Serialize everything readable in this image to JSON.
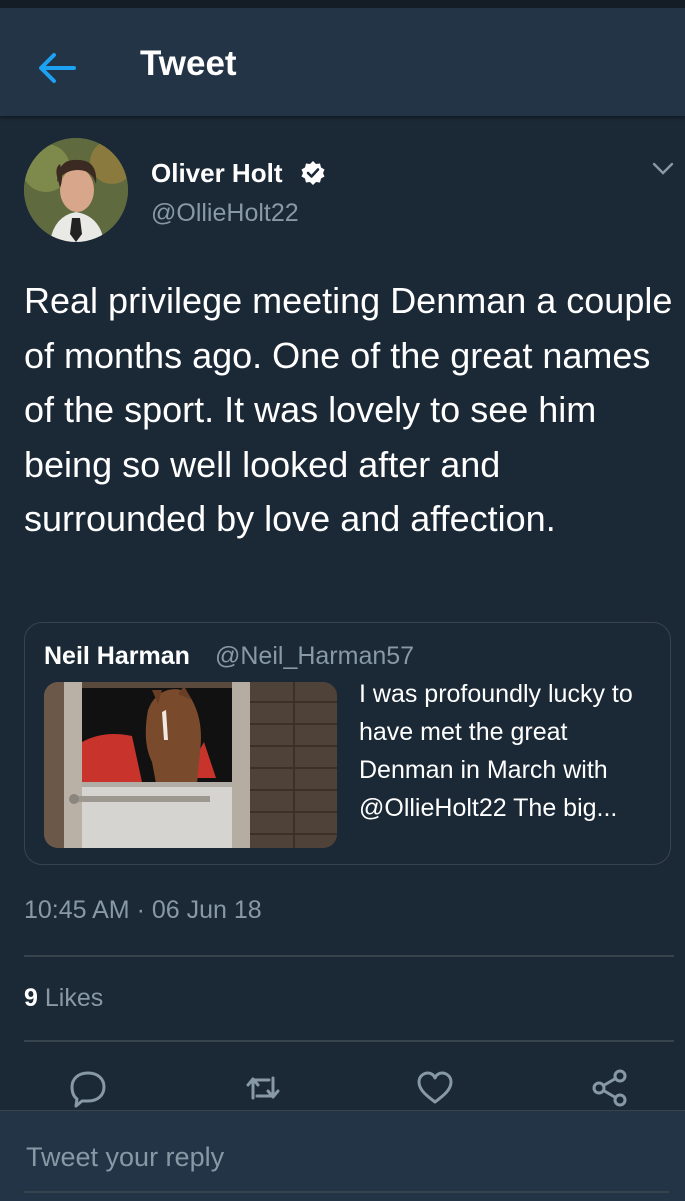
{
  "header": {
    "title": "Tweet",
    "back_icon": "arrow-left-icon"
  },
  "tweet": {
    "author_name": "Oliver Holt",
    "author_handle": "@OllieHolt22",
    "verified": true,
    "text": "Real privilege meeting Denman a couple of months ago. One of the great names of the sport. It was lovely to see him being so well looked after and surrounded by love and affection.",
    "timestamp": "10:45 AM · 06 Jun 18",
    "likes_count": "9",
    "likes_label": "Likes"
  },
  "quoted_tweet": {
    "author_name": "Neil Harman",
    "author_handle": "@Neil_Harman57",
    "text": "I was profoundly lucky to have met the great Denman in March with @OllieHolt22 The big..."
  },
  "actions": [
    {
      "name": "reply",
      "icon": "reply-icon"
    },
    {
      "name": "retweet",
      "icon": "retweet-icon"
    },
    {
      "name": "like",
      "icon": "heart-icon"
    },
    {
      "name": "share",
      "icon": "share-icon"
    }
  ],
  "reply_box": {
    "placeholder": "Tweet your reply"
  },
  "colors": {
    "background": "#1b2836",
    "header": "#243447",
    "accent": "#1da1f2",
    "secondary_text": "#8899a6",
    "border": "#38444d"
  }
}
